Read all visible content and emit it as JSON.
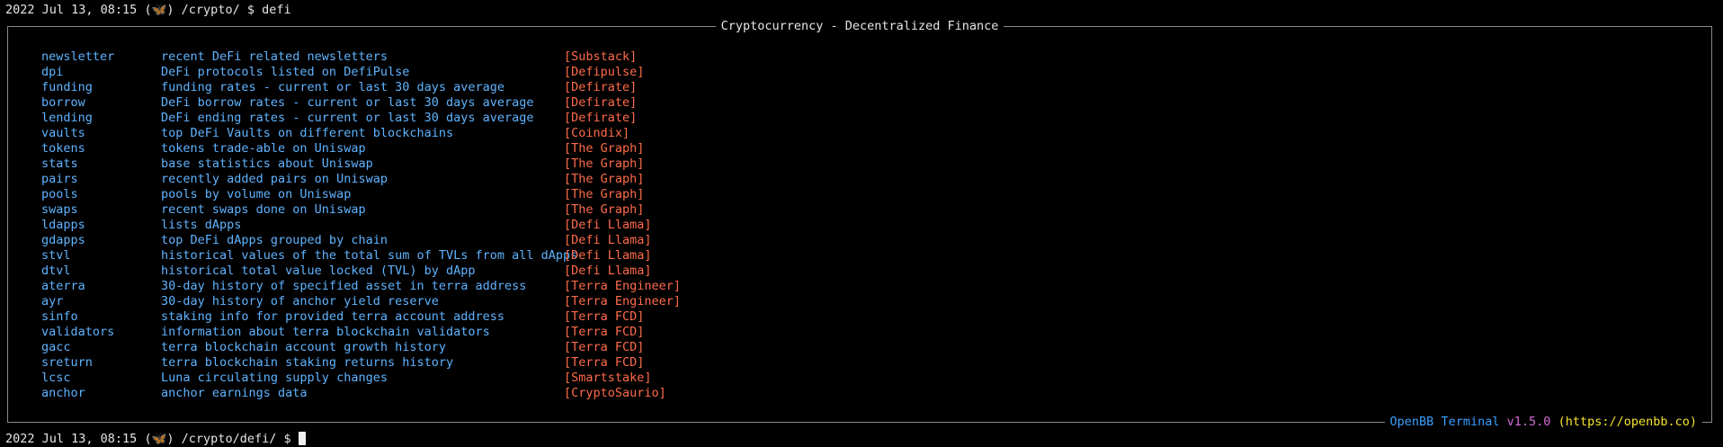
{
  "top_fragment": {
    "left_text": "",
    "right_text": ""
  },
  "prompt_top": {
    "timestamp": "2022 Jul 13, 08:15",
    "icon_glyph": "(🦋)",
    "path": "/crypto/",
    "symbol": "$",
    "command": "defi"
  },
  "panel": {
    "title": "Cryptocurrency - Decentralized Finance",
    "footer": {
      "brand": "OpenBB",
      "terminal": "Terminal",
      "version": "v1.5.0",
      "url": "(https://openbb.co)"
    },
    "commands": [
      {
        "name": "newsletter",
        "description": "recent DeFi related newsletters",
        "source": "[Substack]"
      },
      {
        "name": "dpi",
        "description": "DeFi protocols listed on DefiPulse",
        "source": "[Defipulse]"
      },
      {
        "name": "funding",
        "description": "funding rates - current or last 30 days average",
        "source": "[Defirate]"
      },
      {
        "name": "borrow",
        "description": "DeFi borrow rates - current or last 30 days average",
        "source": "[Defirate]"
      },
      {
        "name": "lending",
        "description": "DeFi ending rates - current or last 30 days average",
        "source": "[Defirate]"
      },
      {
        "name": "vaults",
        "description": "top DeFi Vaults on different blockchains",
        "source": "[Coindix]"
      },
      {
        "name": "tokens",
        "description": "tokens trade-able on Uniswap",
        "source": "[The Graph]"
      },
      {
        "name": "stats",
        "description": "base statistics about Uniswap",
        "source": "[The Graph]"
      },
      {
        "name": "pairs",
        "description": "recently added pairs on Uniswap",
        "source": "[The Graph]"
      },
      {
        "name": "pools",
        "description": "pools by volume on Uniswap",
        "source": "[The Graph]"
      },
      {
        "name": "swaps",
        "description": "recent swaps done on Uniswap",
        "source": "[The Graph]"
      },
      {
        "name": "ldapps",
        "description": "lists dApps",
        "source": "[Defi Llama]"
      },
      {
        "name": "gdapps",
        "description": "top DeFi dApps grouped by chain",
        "source": "[Defi Llama]"
      },
      {
        "name": "stvl",
        "description": "historical values of the total sum of TVLs from all dApps",
        "source": "[Defi Llama]"
      },
      {
        "name": "dtvl",
        "description": "historical total value locked (TVL) by dApp",
        "source": "[Defi Llama]"
      },
      {
        "name": "aterra",
        "description": "30-day history of specified asset in terra address",
        "source": "[Terra Engineer]"
      },
      {
        "name": "ayr",
        "description": "30-day history of anchor yield reserve",
        "source": "[Terra Engineer]"
      },
      {
        "name": "sinfo",
        "description": "staking info for provided terra account address",
        "source": "[Terra FCD]"
      },
      {
        "name": "validators",
        "description": "information about terra blockchain validators",
        "source": "[Terra FCD]"
      },
      {
        "name": "gacc",
        "description": "terra blockchain account growth history",
        "source": "[Terra FCD]"
      },
      {
        "name": "sreturn",
        "description": "terra blockchain staking returns history",
        "source": "[Terra FCD]"
      },
      {
        "name": "lcsc",
        "description": "Luna circulating supply changes",
        "source": "[Smartstake]"
      },
      {
        "name": "anchor",
        "description": "anchor earnings data",
        "source": "[CryptoSaurio]"
      }
    ]
  },
  "prompt_bottom": {
    "timestamp": "2022 Jul 13, 08:15",
    "icon_glyph": "(🦋)",
    "path": "/crypto/defi/",
    "symbol": "$"
  },
  "colors": {
    "background": "#000000",
    "command": "#5fb3ff",
    "source": "#ff6b4a",
    "brand": "#3aa0ff",
    "version": "#d86ad6",
    "url": "#f5e431",
    "border": "#8a8a8a"
  }
}
